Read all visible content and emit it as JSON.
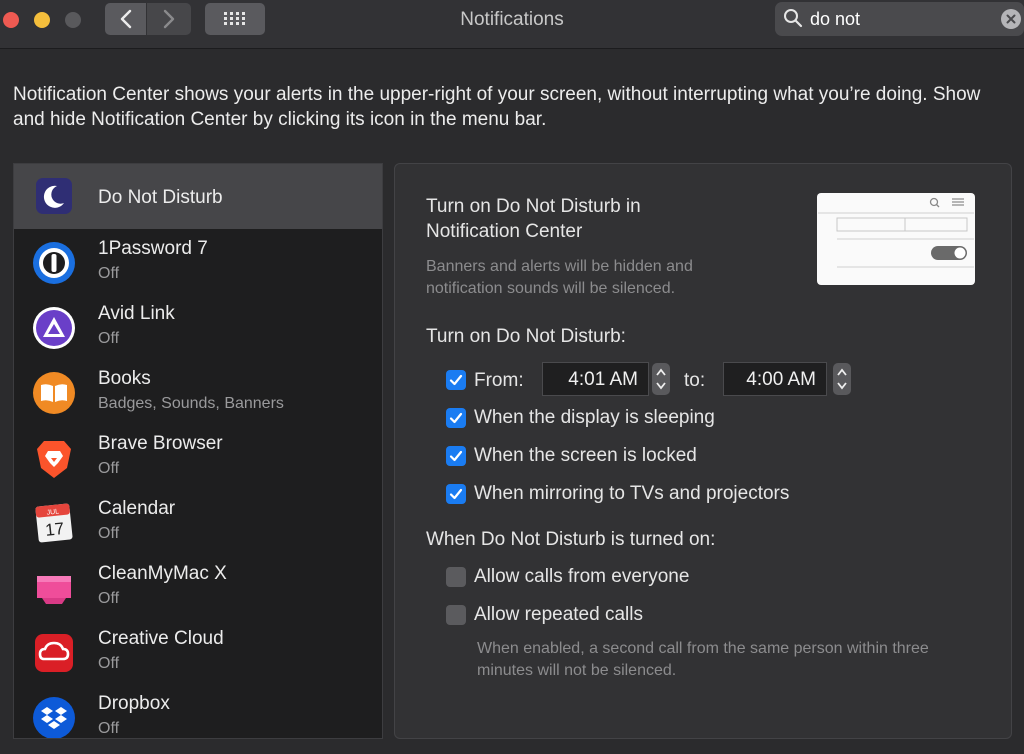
{
  "window": {
    "title": "Notifications"
  },
  "search": {
    "value": "do not"
  },
  "intro": "Notification Center shows your alerts in the upper-right of your screen, without interrupting what you’re doing. Show and hide Notification Center by clicking its icon in the menu bar.",
  "apps": [
    {
      "name": "Do Not Disturb",
      "status": ""
    },
    {
      "name": "1Password 7",
      "status": "Off"
    },
    {
      "name": "Avid Link",
      "status": "Off"
    },
    {
      "name": "Books",
      "status": "Badges, Sounds, Banners"
    },
    {
      "name": "Brave Browser",
      "status": "Off"
    },
    {
      "name": "Calendar",
      "status": "Off",
      "icon_month": "JUL",
      "icon_day": "17"
    },
    {
      "name": "CleanMyMac X",
      "status": "Off"
    },
    {
      "name": "Creative Cloud",
      "status": "Off"
    },
    {
      "name": "Dropbox",
      "status": "Off"
    }
  ],
  "dnd": {
    "heading": "Turn on Do Not Disturb in Notification Center",
    "heading_desc": "Banners and alerts will be hidden and notification sounds will be silenced.",
    "schedule_label": "Turn on Do Not Disturb:",
    "from_label": "From:",
    "from_time": "4:01 AM",
    "to_label": "to:",
    "to_time": "4:00 AM",
    "from_checked": true,
    "options": [
      {
        "label": "When the display is sleeping",
        "checked": true
      },
      {
        "label": "When the screen is locked",
        "checked": true
      },
      {
        "label": "When mirroring to TVs and projectors",
        "checked": true
      }
    ],
    "when_on_label": "When Do Not Disturb is turned on:",
    "calls": [
      {
        "label": "Allow calls from everyone",
        "checked": false
      },
      {
        "label": "Allow repeated calls",
        "checked": false
      }
    ],
    "repeated_desc": "When enabled, a second call from the same person within three minutes will not be silenced."
  },
  "colors": {
    "accent": "#1a7cf2",
    "list_bg": "#1e1e1f",
    "panel_bg": "#323234"
  }
}
